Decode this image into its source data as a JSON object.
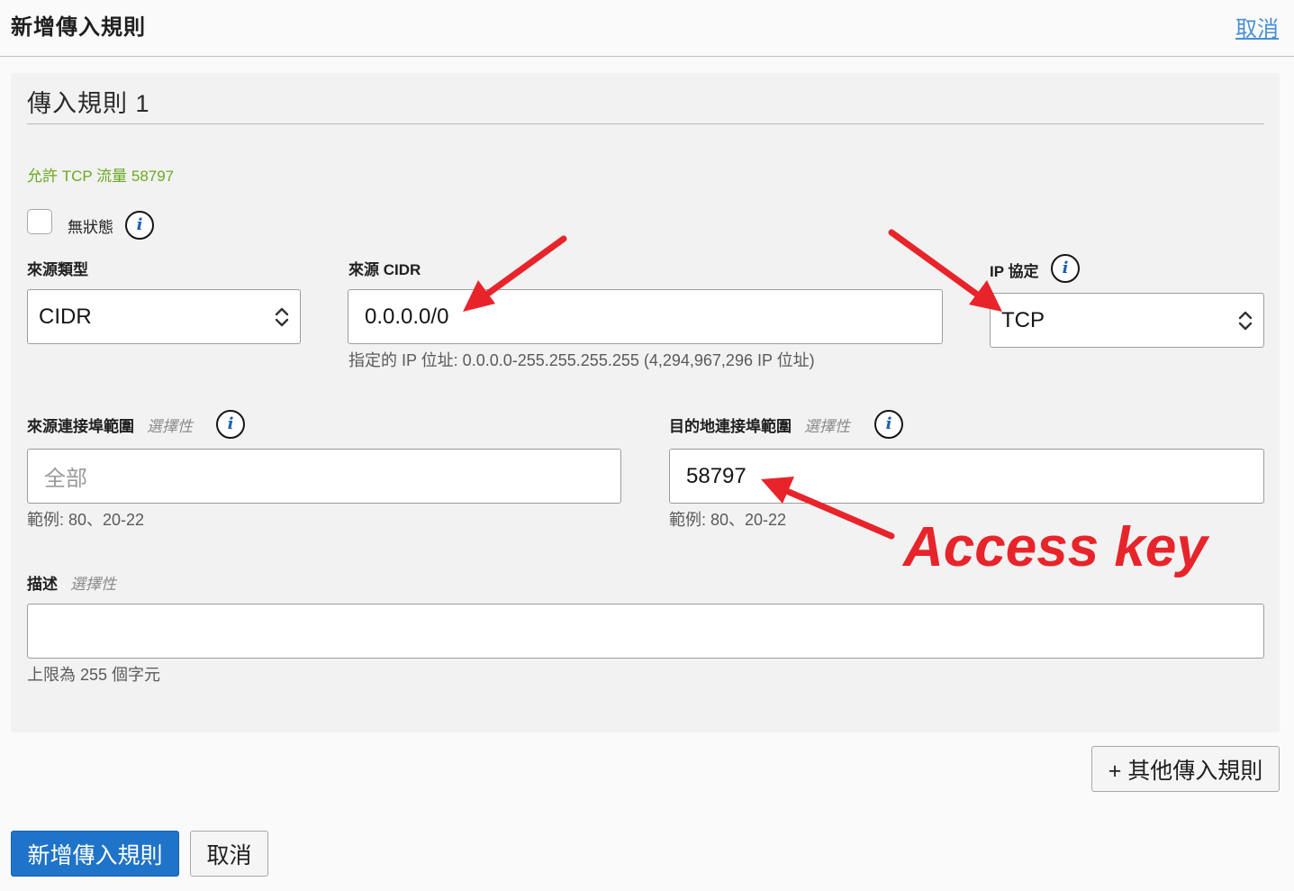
{
  "header": {
    "title": "新增傳入規則",
    "cancel_link": "取消"
  },
  "rule": {
    "title": "傳入規則 1",
    "summary": "允許 TCP 流量 58797",
    "stateless_label": "無狀態",
    "stateless_checked": false
  },
  "source_type": {
    "label": "來源類型",
    "value": "CIDR"
  },
  "source_cidr": {
    "label": "來源 CIDR",
    "value": "0.0.0.0/0",
    "hint": "指定的 IP 位址: 0.0.0.0-255.255.255.255 (4,294,967,296 IP 位址)"
  },
  "ip_protocol": {
    "label": "IP 協定",
    "value": "TCP"
  },
  "source_port": {
    "label": "來源連接埠範圍",
    "optional": "選擇性",
    "placeholder": "全部",
    "hint": "範例: 80、20-22"
  },
  "dest_port": {
    "label": "目的地連接埠範圍",
    "optional": "選擇性",
    "value": "58797",
    "hint": "範例: 80、20-22"
  },
  "description": {
    "label": "描述",
    "optional": "選擇性",
    "value": "",
    "hint": "上限為 255 個字元"
  },
  "buttons": {
    "add_another": "+ 其他傳入規則",
    "submit": "新增傳入規則",
    "cancel": "取消"
  },
  "annotation": {
    "text": "Access key",
    "color": "#e8242b"
  },
  "colors": {
    "primary": "#1f73c8",
    "summary_green": "#6aa923",
    "link": "#4a8fd6"
  },
  "icons": {
    "info": "info-icon",
    "select_chevron": "chevron-updown-icon"
  }
}
